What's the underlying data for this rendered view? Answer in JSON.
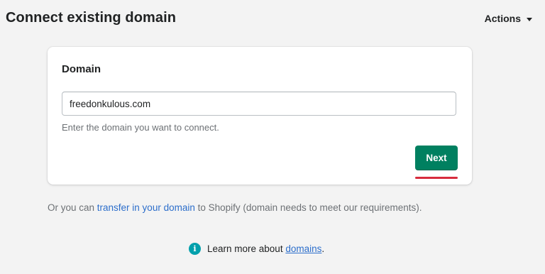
{
  "header": {
    "title": "Connect existing domain",
    "actions_label": "Actions"
  },
  "card": {
    "heading": "Domain",
    "input_value": "freedonkulous.com",
    "help_text": "Enter the domain you want to connect.",
    "next_label": "Next"
  },
  "transfer": {
    "prefix": "Or you can ",
    "link_text": "transfer in your domain",
    "suffix": " to Shopify (domain needs to meet our requirements)."
  },
  "learn_more": {
    "icon": "info-icon",
    "prefix": "Learn more about ",
    "link_text": "domains",
    "suffix": "."
  },
  "colors": {
    "primary_button": "#008060",
    "link": "#2c6ecb",
    "info_icon": "#00a0ac",
    "annotation_underline": "#d72c3d"
  }
}
